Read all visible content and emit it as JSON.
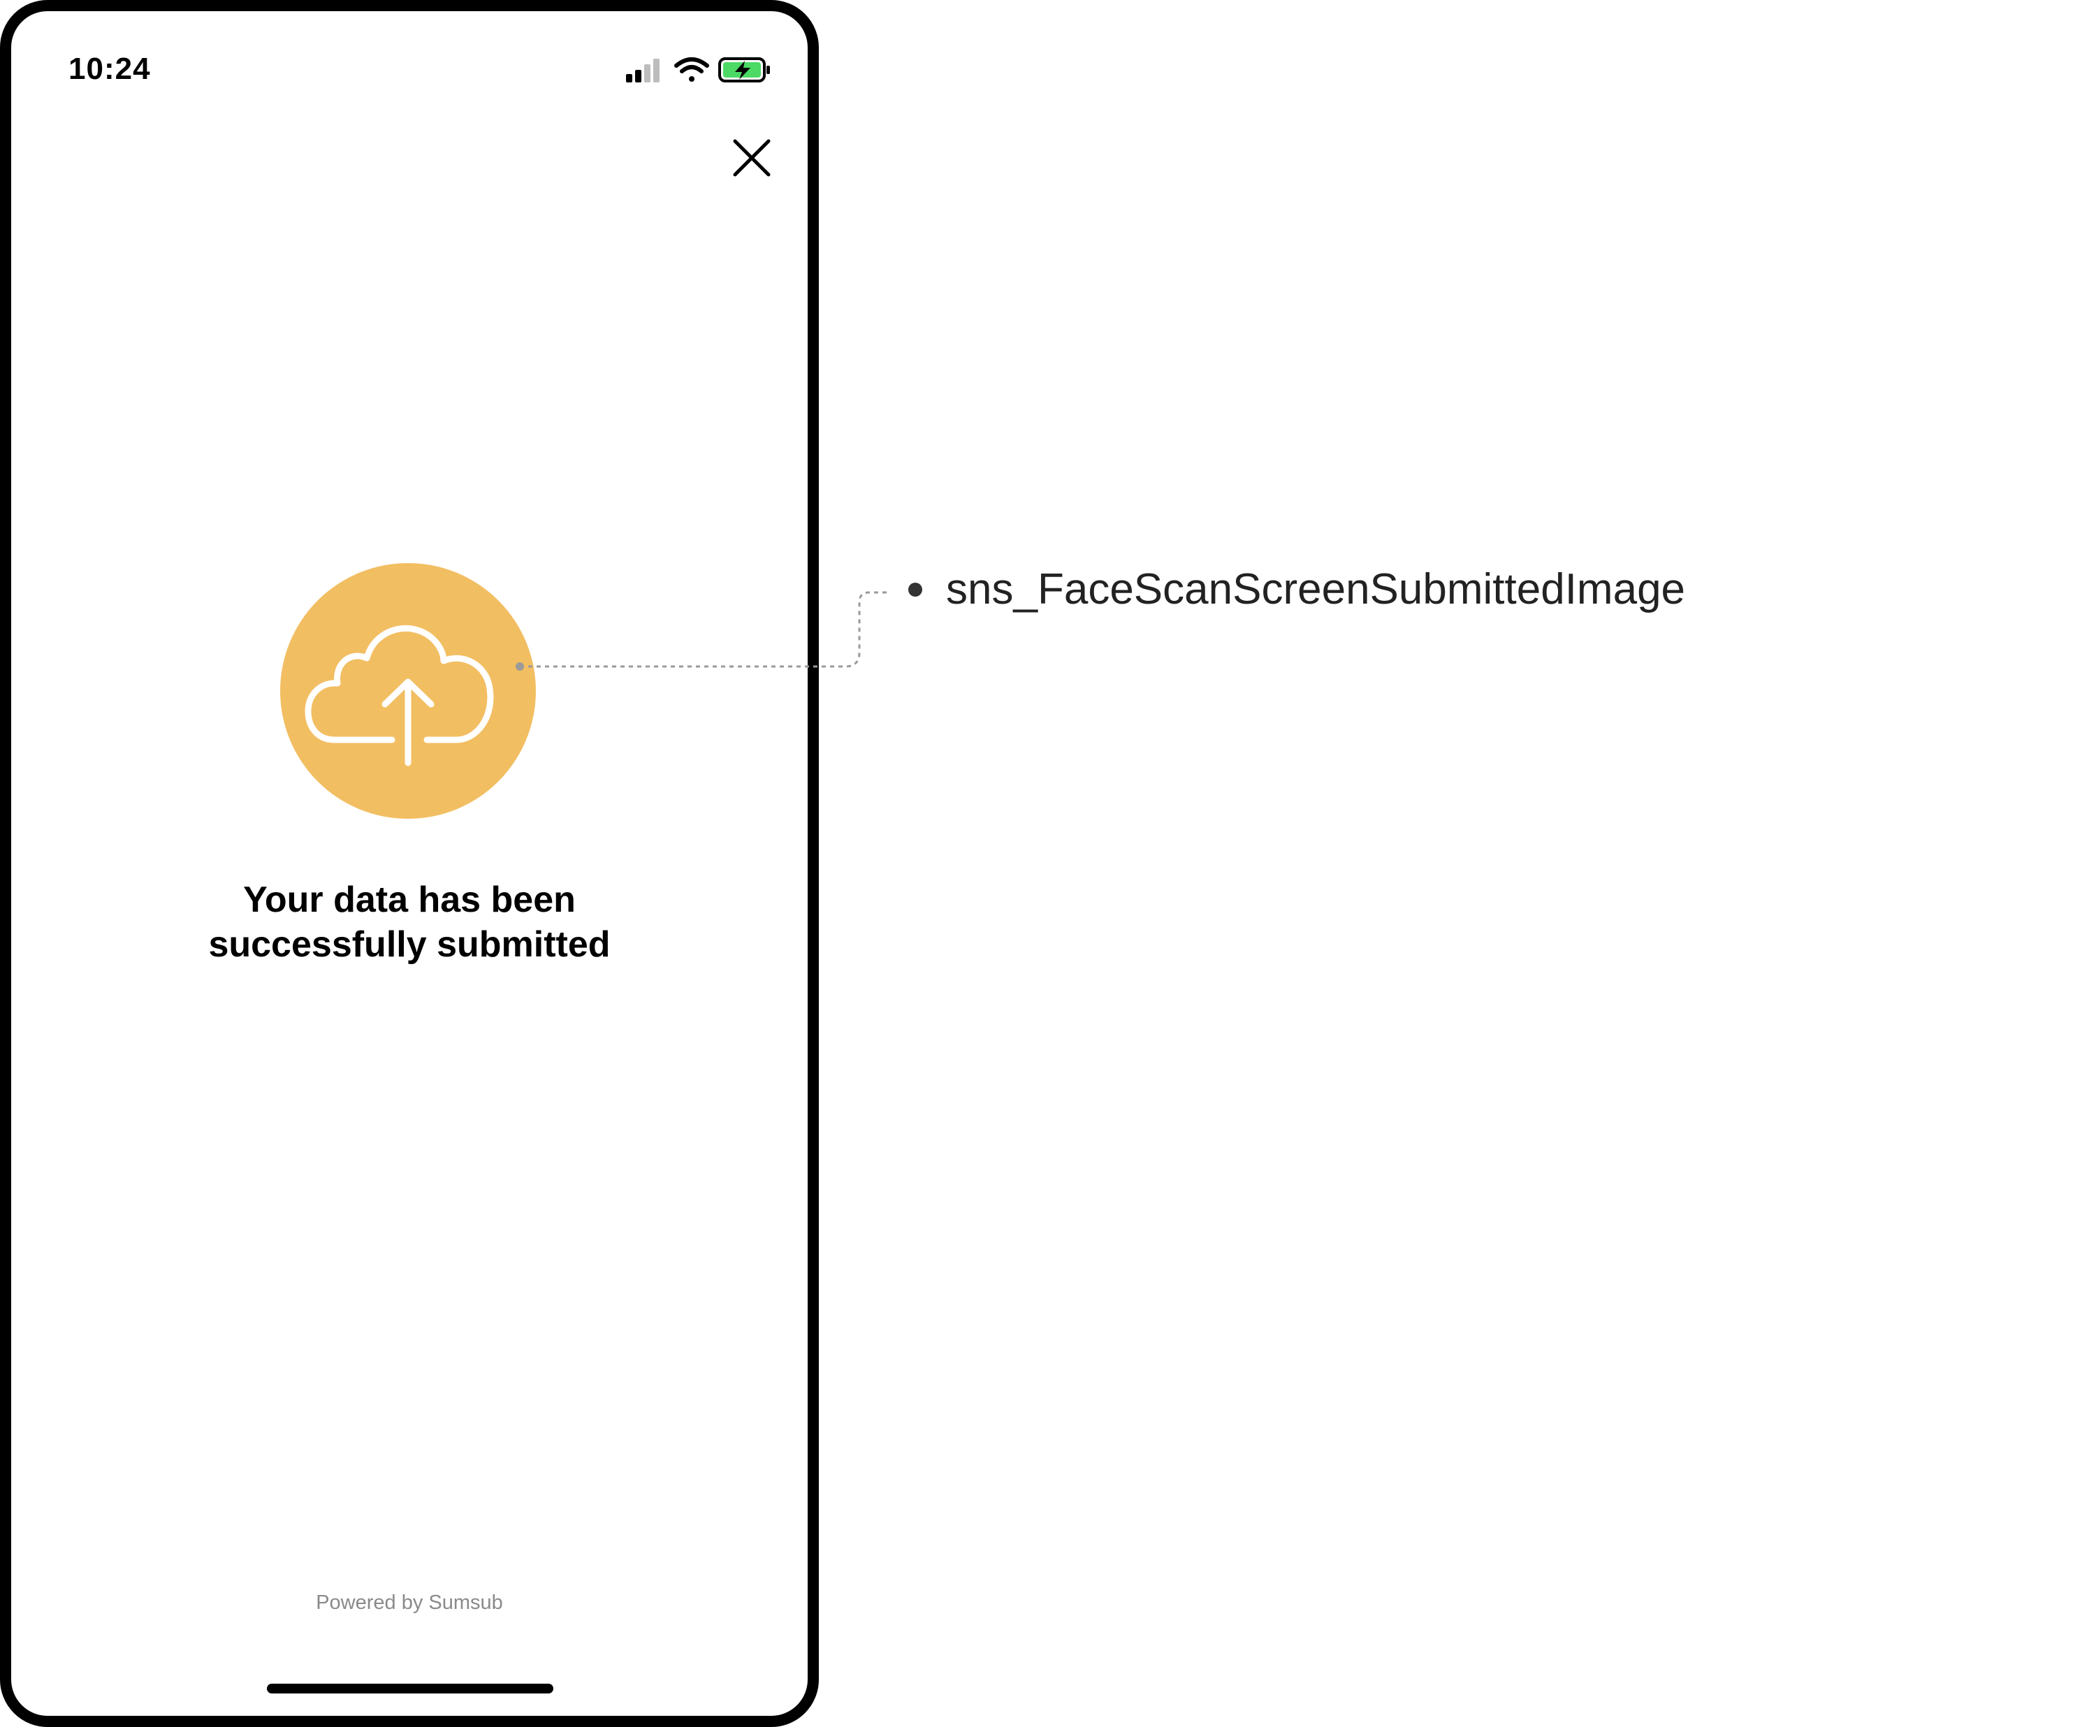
{
  "status_bar": {
    "time": "10:24",
    "icons": [
      "cellular-signal-icon",
      "wifi-icon",
      "battery-charging-icon"
    ]
  },
  "screen": {
    "close_icon": "close-icon",
    "hero_icon": "cloud-upload-icon",
    "message": "Your data has been successfully submitted",
    "powered_by": "Powered by Sumsub"
  },
  "annotation": {
    "label": "sns_FaceScanScreenSubmittedImage"
  },
  "colors": {
    "hero_circle": "#F2BE62",
    "frame": "#000000",
    "battery_fill": "#4CD964"
  }
}
